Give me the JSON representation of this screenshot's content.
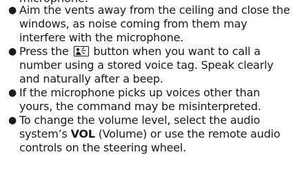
{
  "partial_top_line": "microphone.",
  "tips": {
    "vents": "Aim the vents away from the ceiling and close the windows, as noise coming from them may interfere with the microphone.",
    "press_before": "Press the",
    "press_after": "button when you want to call a number using a stored voice tag. Speak clearly and naturally after a beep.",
    "mic_voices": "If the microphone picks up voices other than yours, the command may be misinterpreted.",
    "volume_before": "To change the volume level, select the audio system’s",
    "volume_bold": "VOL",
    "volume_after": "(Volume) or use the remote audio controls on the steering wheel."
  },
  "icons": {
    "talk": "talk-button-icon"
  }
}
